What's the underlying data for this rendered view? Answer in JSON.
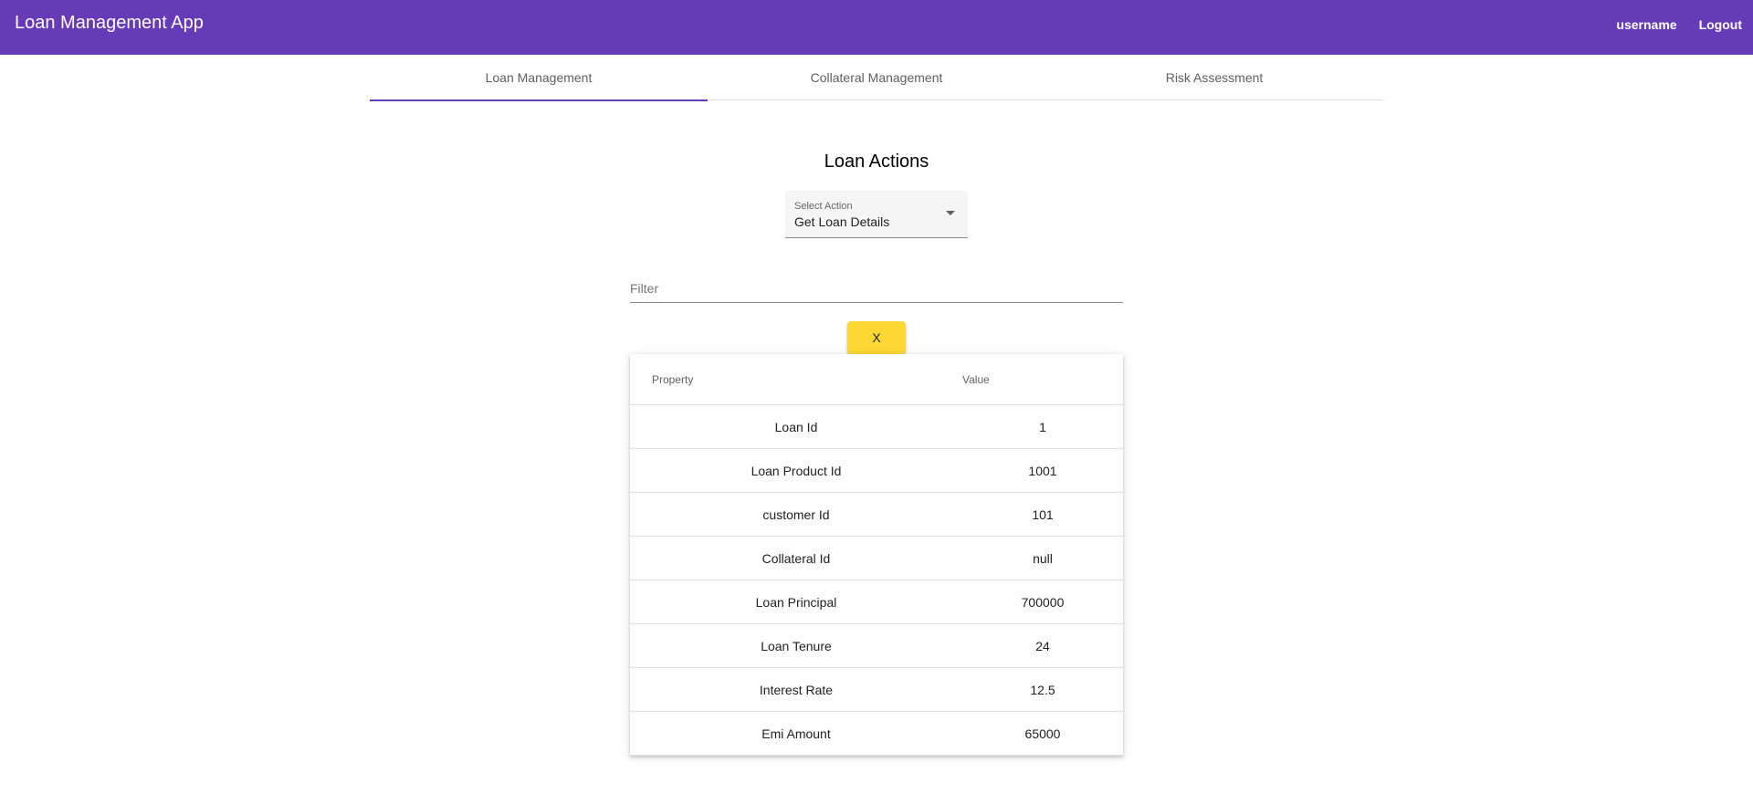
{
  "toolbar": {
    "title": "Loan Management App",
    "username_label": "username",
    "logout_label": "Logout"
  },
  "tabs": [
    {
      "label": "Loan Management",
      "active": true
    },
    {
      "label": "Collateral Management",
      "active": false
    },
    {
      "label": "Risk Assessment",
      "active": false
    }
  ],
  "main": {
    "title": "Loan Actions",
    "select": {
      "label": "Select Action",
      "value": "Get Loan Details"
    },
    "filter": {
      "placeholder": "Filter",
      "value": ""
    },
    "clear_label": "X"
  },
  "table": {
    "headers": {
      "property": "Property",
      "value": "Value"
    },
    "rows": [
      {
        "property": "Loan Id",
        "value": "1"
      },
      {
        "property": "Loan Product Id",
        "value": "1001"
      },
      {
        "property": "customer Id",
        "value": "101"
      },
      {
        "property": "Collateral Id",
        "value": "null"
      },
      {
        "property": "Loan Principal",
        "value": "700000"
      },
      {
        "property": "Loan Tenure",
        "value": "24"
      },
      {
        "property": "Interest Rate",
        "value": "12.5"
      },
      {
        "property": "Emi Amount",
        "value": "65000"
      }
    ]
  },
  "colors": {
    "primary": "#673ab7",
    "accent_button": "#fdd835"
  }
}
